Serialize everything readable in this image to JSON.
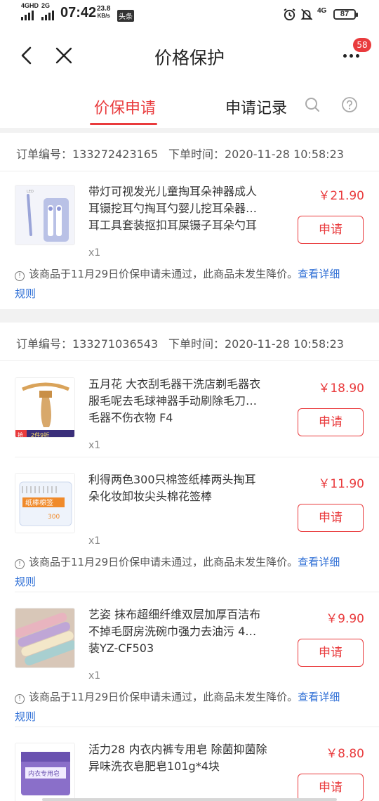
{
  "status": {
    "signal1": "4GHD",
    "signal2": "2G",
    "time": "07:42",
    "net_speed_value": "23.8",
    "net_speed_unit": "KB/s",
    "app_badge": "头条",
    "lte": "4G",
    "battery": "87"
  },
  "nav": {
    "title": "价格保护",
    "badge": "58"
  },
  "tabs": {
    "active": "价保申请",
    "records": "申请记录"
  },
  "orders": [
    {
      "order_no": "订单编号：133272423165",
      "order_time": "下单时间：2020-11-28 10:58:23",
      "items": [
        {
          "name": [
            "带灯可视发光儿童掏耳朵神器成人",
            "耳镊挖耳勺掏耳勺婴儿挖耳朵器…",
            "耳工具套装抠扣耳屎镊子耳朵勺耳"
          ],
          "price": "￥21.90",
          "apply": "申请",
          "qty": "x1",
          "notice_text": "该商品于11月29日价保申请未通过，此商品未发生降价。",
          "notice_link1": "查看详细",
          "notice_link2": "规则"
        }
      ]
    },
    {
      "order_no": "订单编号：133271036543",
      "order_time": "下单时间：2020-11-28 10:58:23",
      "items": [
        {
          "name": [
            "五月花 大衣刮毛器干洗店剃毛器衣",
            "服毛呢去毛球神器手动刷除毛刀…",
            "毛器不伤衣物 F4"
          ],
          "price": "￥18.90",
          "apply": "申请",
          "qty": "x1",
          "thumb_tag1": "抢",
          "thumb_tag2": "2件9折"
        },
        {
          "name": [
            "利得两色300只棉签纸棒两头掏耳",
            "朵化妆卸妆尖头棉花签棒"
          ],
          "price": "￥11.90",
          "apply": "申请",
          "qty": "x1",
          "thumb_box": "纸棒棉签",
          "thumb_count": "300",
          "notice_text": "该商品于11月29日价保申请未通过，此商品未发生降价。",
          "notice_link1": "查看详细",
          "notice_link2": "规则"
        },
        {
          "name": [
            "艺姿 抹布超细纤维双层加厚百洁布",
            "不掉毛厨房洗碗巾强力去油污 4…",
            "装YZ-CF503"
          ],
          "price": "￥9.90",
          "apply": "申请",
          "qty": "x1",
          "notice_text": "该商品于11月29日价保申请未通过，此商品未发生降价。",
          "notice_link1": "查看详细",
          "notice_link2": "规则"
        },
        {
          "name": [
            "活力28 内衣内裤专用皂 除菌抑菌除",
            "异味洗衣皂肥皂101g*4块"
          ],
          "price": "￥8.80",
          "apply": "申请",
          "thumb_box": "内衣专用皂"
        }
      ]
    }
  ],
  "colors": {
    "accent": "#e93b3d",
    "link": "#2f6fd6"
  }
}
